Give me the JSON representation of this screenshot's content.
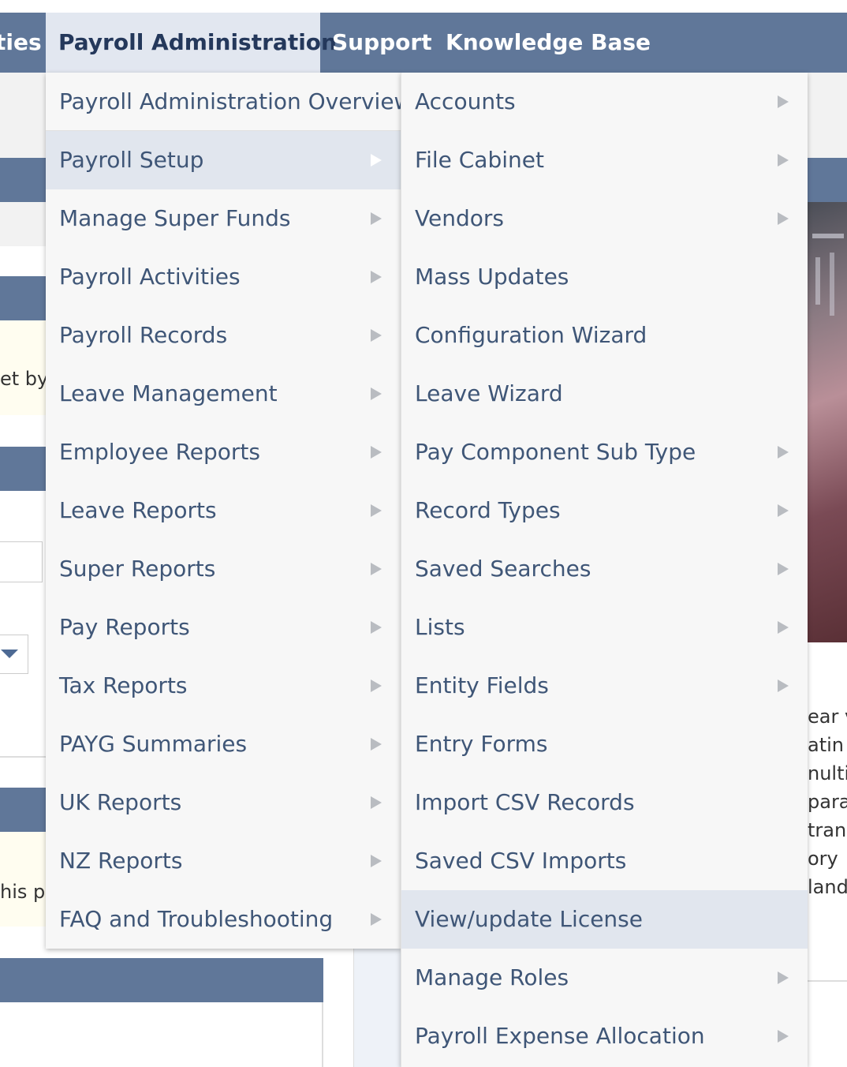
{
  "nav": {
    "prev_fragment": "ties",
    "payroll": "Payroll Administration",
    "support": "Support",
    "knowledge_base": "Knowledge Base"
  },
  "background": {
    "left_text_1": "et by",
    "left_text_2": "his po",
    "right_lines": [
      "ear v",
      "atin",
      "nulti",
      "para",
      "tran",
      "ory",
      "land"
    ]
  },
  "menu1": {
    "items": [
      {
        "label": "Payroll Administration Overview",
        "submenu": false
      },
      {
        "label": "Payroll Setup",
        "submenu": true,
        "active": true
      },
      {
        "label": "Manage Super Funds",
        "submenu": true
      },
      {
        "label": "Payroll Activities",
        "submenu": true
      },
      {
        "label": "Payroll Records",
        "submenu": true
      },
      {
        "label": "Leave Management",
        "submenu": true
      },
      {
        "label": "Employee Reports",
        "submenu": true
      },
      {
        "label": "Leave Reports",
        "submenu": true
      },
      {
        "label": "Super Reports",
        "submenu": true
      },
      {
        "label": "Pay Reports",
        "submenu": true
      },
      {
        "label": "Tax Reports",
        "submenu": true
      },
      {
        "label": "PAYG Summaries",
        "submenu": true
      },
      {
        "label": "UK Reports",
        "submenu": true
      },
      {
        "label": "NZ Reports",
        "submenu": true
      },
      {
        "label": "FAQ and Troubleshooting",
        "submenu": true
      }
    ]
  },
  "menu2": {
    "items": [
      {
        "label": "Accounts",
        "submenu": true
      },
      {
        "label": "File Cabinet",
        "submenu": true
      },
      {
        "label": "Vendors",
        "submenu": true
      },
      {
        "label": "Mass Updates",
        "submenu": false
      },
      {
        "label": "Configuration Wizard",
        "submenu": false
      },
      {
        "label": "Leave Wizard",
        "submenu": false
      },
      {
        "label": "Pay Component Sub Type",
        "submenu": true
      },
      {
        "label": "Record Types",
        "submenu": true
      },
      {
        "label": "Saved Searches",
        "submenu": true
      },
      {
        "label": "Lists",
        "submenu": true
      },
      {
        "label": "Entity Fields",
        "submenu": true
      },
      {
        "label": "Entry Forms",
        "submenu": false
      },
      {
        "label": "Import CSV Records",
        "submenu": false
      },
      {
        "label": "Saved CSV Imports",
        "submenu": false
      },
      {
        "label": "View/update License",
        "submenu": false,
        "active": true
      },
      {
        "label": "Manage Roles",
        "submenu": true
      },
      {
        "label": "Payroll Expense Allocation",
        "submenu": true
      }
    ]
  },
  "colors": {
    "nav_bar": "#607799",
    "nav_active_bg": "#e2e7f0",
    "menu_bg": "#f7f7f7",
    "menu_active_bg": "#e1e6ee",
    "menu_text": "#3f5677"
  }
}
